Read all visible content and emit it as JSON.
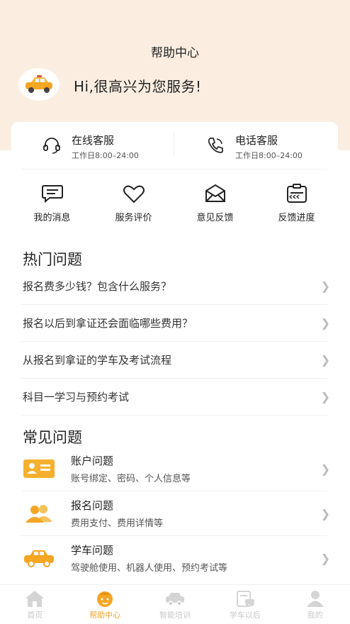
{
  "header": {
    "title": "帮助中心",
    "greeting": "Hi,很高兴为您服务!"
  },
  "services": [
    {
      "name": "在线客服",
      "hours": "工作日8:00–24:00",
      "icon": "headset-icon"
    },
    {
      "name": "电话客服",
      "hours": "工作日8:00–24:00",
      "icon": "phone-icon"
    }
  ],
  "quick_actions": [
    {
      "label": "我的消息",
      "icon": "message-icon"
    },
    {
      "label": "服务评价",
      "icon": "heart-icon"
    },
    {
      "label": "意见反馈",
      "icon": "mail-icon"
    },
    {
      "label": "反馈进度",
      "icon": "clipboard-icon"
    }
  ],
  "hot": {
    "title": "热门问题",
    "items": [
      "报名费多少钱？包含什么服务？",
      "报名以后到拿证还会面临哪些费用？",
      "从报名到拿证的学车及考试流程",
      "科目一学习与预约考试"
    ]
  },
  "common": {
    "title": "常见问题",
    "items": [
      {
        "name": "账户问题",
        "desc": "账号绑定、密码、个人信息等",
        "icon": "id-card-icon"
      },
      {
        "name": "报名问题",
        "desc": "费用支付、费用详情等",
        "icon": "users-icon"
      },
      {
        "name": "学车问题",
        "desc": "驾驶舱使用、机器人使用、预约考试等",
        "icon": "car-icon"
      }
    ]
  },
  "tabs": [
    {
      "label": "首页",
      "icon": "home-icon",
      "active": false
    },
    {
      "label": "帮助中心",
      "icon": "help-face-icon",
      "active": true
    },
    {
      "label": "智能培训",
      "icon": "training-car-icon",
      "active": false
    },
    {
      "label": "学车以后",
      "icon": "after-license-icon",
      "active": false
    },
    {
      "label": "我的",
      "icon": "profile-icon",
      "active": false
    }
  ],
  "colors": {
    "accent": "#f2a22c",
    "header_bg": "#fbeee1",
    "inactive_tab": "#c8c8c8"
  }
}
